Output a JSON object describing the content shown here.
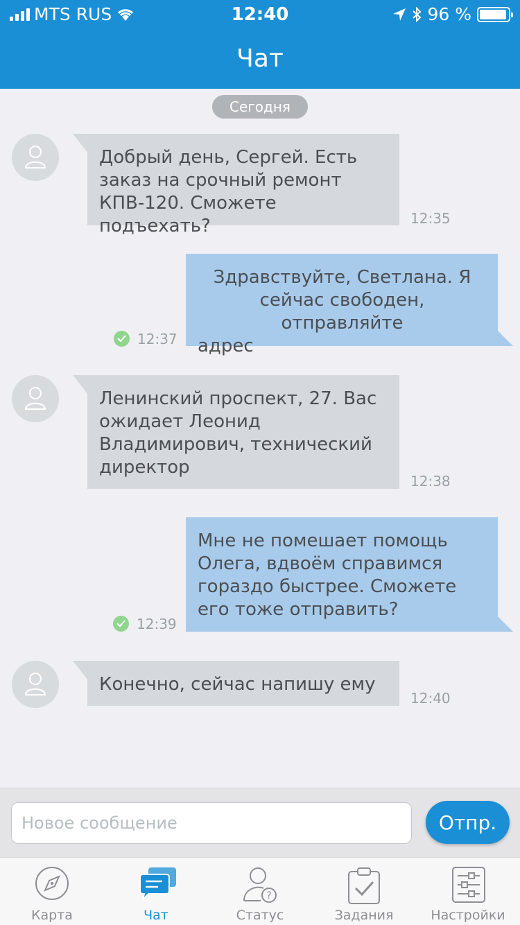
{
  "status_bar": {
    "carrier": "MTS RUS",
    "time": "12:40",
    "battery": "96 %",
    "battery_level": 0.96
  },
  "header": {
    "title": "Чат"
  },
  "date_divider": "Сегодня",
  "messages": [
    {
      "direction": "incoming",
      "lines": [
        "Добрый день, Сергей. Есть",
        "заказ на срочный ремонт",
        "КПВ-120. Сможете подъехать?"
      ],
      "time": "12:35"
    },
    {
      "direction": "outgoing",
      "lines": [
        "Здравствуйте, Светлана. Я",
        "сейчас свободен, отправляйте",
        "адрес"
      ],
      "time": "12:37",
      "delivered": true
    },
    {
      "direction": "incoming",
      "lines": [
        "Ленинский проспект, 27. Вас",
        "ожидает Леонид",
        "Владимирович, технический",
        "директор"
      ],
      "time": "12:38"
    },
    {
      "direction": "outgoing",
      "lines": [
        "Мне не помешает помощь",
        "Олега, вдвоём справимся",
        "гораздо быстрее. Сможете",
        "его тоже отправить?"
      ],
      "time": "12:39",
      "delivered": true
    },
    {
      "direction": "incoming",
      "lines": [
        "Конечно, сейчас напишу ему"
      ],
      "time": "12:40"
    }
  ],
  "composer": {
    "placeholder": "Новое сообщение",
    "value": "",
    "send_label": "Отпр."
  },
  "tabs": [
    {
      "label": "Карта",
      "icon": "compass-icon",
      "active": false
    },
    {
      "label": "Чат",
      "icon": "chat-icon",
      "active": true
    },
    {
      "label": "Статус",
      "icon": "user-question-icon",
      "active": false
    },
    {
      "label": "Задания",
      "icon": "clipboard-check-icon",
      "active": false
    },
    {
      "label": "Настройки",
      "icon": "sliders-icon",
      "active": false
    }
  ],
  "colors": {
    "accent": "#1a8fd6",
    "incoming_bubble": "#d5d8dc",
    "outgoing_bubble": "#a9cbeb",
    "delivered": "#8fd58e"
  }
}
